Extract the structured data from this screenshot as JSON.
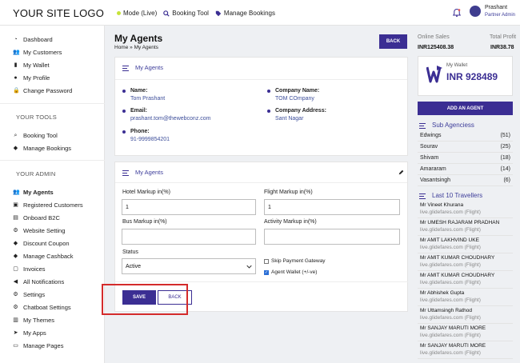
{
  "header": {
    "logo": "YOUR SITE LOGO",
    "nav": [
      {
        "label": "Mode (Live)"
      },
      {
        "label": "Booking Tool"
      },
      {
        "label": "Manage Bookings"
      }
    ],
    "user": {
      "name": "Prashant",
      "role": "Partner Admin"
    }
  },
  "sidebar": {
    "items_main": [
      {
        "label": "Dashboard",
        "icon": "speedometer-icon"
      },
      {
        "label": "My Customers",
        "icon": "users-icon"
      },
      {
        "label": "My Wallet",
        "icon": "wallet-icon"
      },
      {
        "label": "My Profile",
        "icon": "user-icon"
      },
      {
        "label": "Change Password",
        "icon": "lock-icon"
      }
    ],
    "tools_heading": "YOUR TOOLS",
    "items_tools": [
      {
        "label": "Booking Tool",
        "icon": "search-icon"
      },
      {
        "label": "Manage Bookings",
        "icon": "tag-icon"
      }
    ],
    "admin_heading": "YOUR ADMIN",
    "items_admin": [
      {
        "label": "My Agents",
        "icon": "group-icon",
        "active": true
      },
      {
        "label": "Registered Customers",
        "icon": "registered-icon"
      },
      {
        "label": "Onboard B2C",
        "icon": "onboard-icon"
      },
      {
        "label": "Website Setting",
        "icon": "gears-icon"
      },
      {
        "label": "Discount Coupon",
        "icon": "coupon-icon"
      },
      {
        "label": "Manage Cashback",
        "icon": "cashback-icon"
      },
      {
        "label": "Invoices",
        "icon": "invoice-icon"
      },
      {
        "label": "All Notifications",
        "icon": "megaphone-icon"
      },
      {
        "label": "Settings",
        "icon": "gear-icon"
      },
      {
        "label": "Chatboat Settings",
        "icon": "chat-gear-icon"
      },
      {
        "label": "My Themes",
        "icon": "theme-icon"
      },
      {
        "label": "My Apps",
        "icon": "paper-plane-icon"
      },
      {
        "label": "Manage Pages",
        "icon": "page-icon"
      }
    ]
  },
  "page": {
    "title": "My Agents",
    "breadcrumb": "Home » My Agents",
    "back_label": "BACK"
  },
  "agent_card": {
    "heading": "My Agents",
    "name_label": "Name:",
    "name_value": "Tom Prashant",
    "company_label": "Company Name:",
    "company_value": "TOM COmpany",
    "email_label": "Email:",
    "email_value": "prashant.tom@thewebconz.com",
    "address_label": "Company Address:",
    "address_value": "Sant Nagar",
    "phone_label": "Phone:",
    "phone_value": "91-9999854201"
  },
  "markup_card": {
    "heading": "My Agents",
    "hotel_label": "Hotel Markup in(%)",
    "hotel_value": "1",
    "flight_label": "Flight Markup in(%)",
    "flight_value": "1",
    "bus_label": "Bus Markup in(%)",
    "bus_value": "",
    "activity_label": "Activity Markup in(%)",
    "activity_value": "",
    "status_label": "Status",
    "status_value": "Active",
    "skip_payment_label": "Skip Payment Gateway",
    "skip_payment_checked": false,
    "agent_wallet_label": "Agent Wallet (+/-ve)",
    "agent_wallet_checked": true,
    "save_label": "SAVE",
    "back_label": "BACK"
  },
  "right": {
    "online_sales_label": "Online Sales",
    "online_sales_value": "INR125408.38",
    "total_profit_label": "Total Profit",
    "total_profit_value": "INR38.78",
    "wallet_label": "My Wallet",
    "wallet_amount": "INR 928489",
    "add_agent_label": "ADD AN AGENT",
    "sub_agencies_heading": "Sub Agenciess",
    "sub_agencies": [
      {
        "name": "Edwings",
        "count": "(51)"
      },
      {
        "name": "Sourav",
        "count": "(25)"
      },
      {
        "name": "Shivam",
        "count": "(18)"
      },
      {
        "name": "Amararam",
        "count": "(14)"
      },
      {
        "name": "Vasantsingh",
        "count": "(6)"
      }
    ],
    "travellers_heading": "Last 10 Travellers",
    "travellers": [
      {
        "name": "Mr Vineet Khurana",
        "site": "live.glidefares.com (Flight)"
      },
      {
        "name": "Mr UMESH RAJARAM PRADHAN",
        "site": "live.glidefares.com (Flight)"
      },
      {
        "name": "Mr AMIT LAKHVIND UKE",
        "site": "live.glidefares.com (Flight)"
      },
      {
        "name": "Mr AMIT KUMAR CHOUDHARY",
        "site": "live.glidefares.com (Flight)"
      },
      {
        "name": "Mr AMIT KUMAR CHOUDHARY",
        "site": "live.glidefares.com (Flight)"
      },
      {
        "name": "Mr Abhishek Gupta",
        "site": "live.glidefares.com (Flight)"
      },
      {
        "name": "Mr Uttamsingh Rathod",
        "site": "live.glidefares.com (Flight)"
      },
      {
        "name": "Mr SANJAY MARUTI MORE",
        "site": "live.glidefares.com (Flight)"
      },
      {
        "name": "Mr SANJAY MARUTI MORE",
        "site": "live.glidefares.com (Flight)"
      }
    ]
  },
  "colors": {
    "primary": "#3b2e93",
    "highlight": "#d42b2b",
    "live_dot": "#c6e33a"
  }
}
